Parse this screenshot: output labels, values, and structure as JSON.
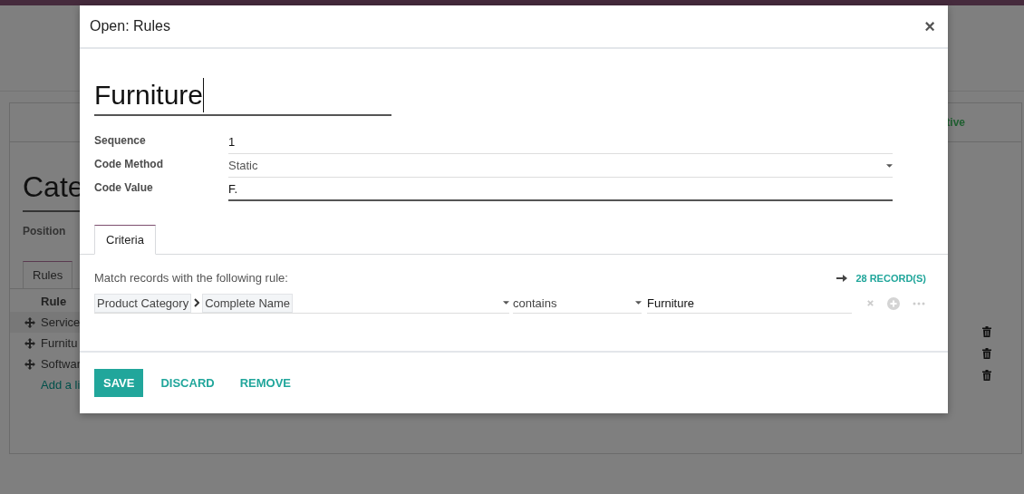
{
  "background": {
    "heading": "Cate",
    "position_label": "Position",
    "status": "tive",
    "tabs": [
      {
        "label": "Rules",
        "selected": true
      }
    ],
    "table": {
      "columns": [
        "Rule"
      ],
      "rows": [
        {
          "name": "Service"
        },
        {
          "name": "Furnitu"
        },
        {
          "name": "Softwar"
        }
      ],
      "add_line": "Add a li"
    }
  },
  "dialog": {
    "title": "Open: Rules",
    "close": "×",
    "name": "Furniture",
    "fields": [
      {
        "label": "Sequence",
        "value": "1",
        "kind": "text",
        "focused": false
      },
      {
        "label": "Code Method",
        "value": "Static",
        "kind": "select",
        "focused": false
      },
      {
        "label": "Code Value",
        "value": "F.",
        "kind": "text",
        "focused": true
      }
    ],
    "tabs": [
      {
        "label": "Criteria",
        "selected": true
      }
    ],
    "domain": {
      "intro": "Match records with the following rule:",
      "records": "28 RECORD(S)",
      "path": [
        "Product Category",
        "Complete Name"
      ],
      "operator": "contains",
      "value": "Furniture"
    },
    "buttons": [
      {
        "label": "SAVE",
        "kind": "primary"
      },
      {
        "label": "DISCARD",
        "kind": "link"
      },
      {
        "label": "REMOVE",
        "kind": "link"
      }
    ]
  }
}
